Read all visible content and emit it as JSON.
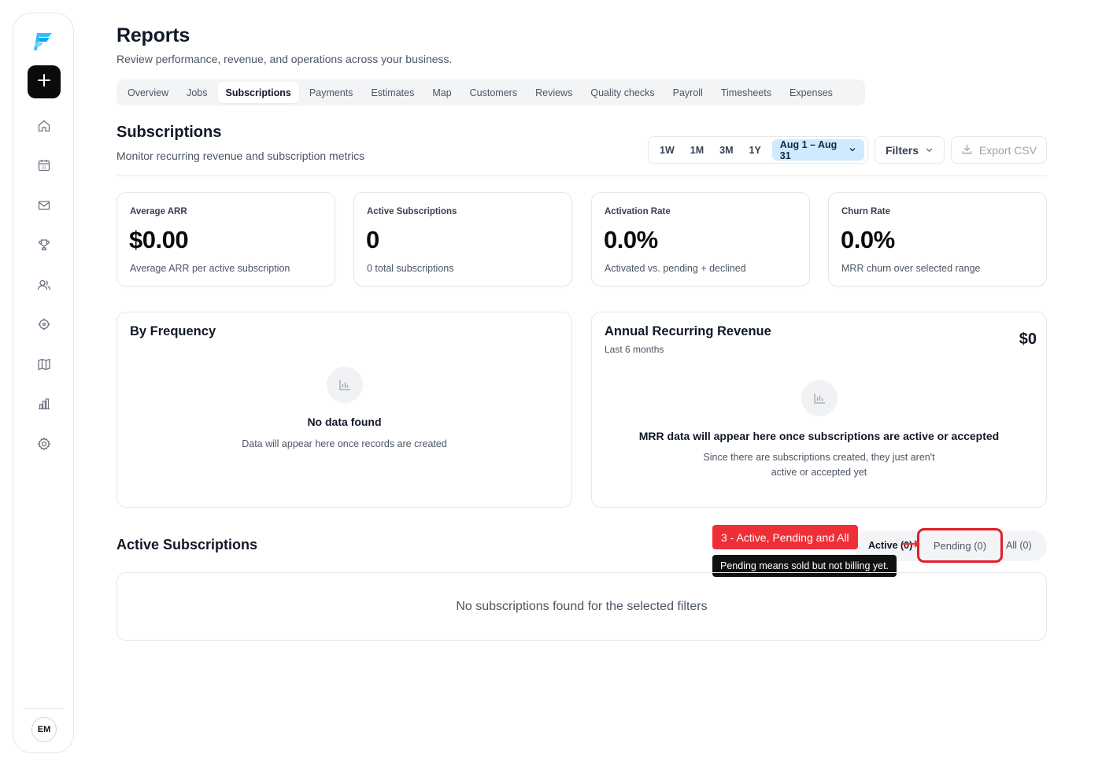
{
  "header": {
    "title": "Reports",
    "subtitle": "Review performance, revenue, and operations across your business."
  },
  "tabs": [
    {
      "label": "Overview"
    },
    {
      "label": "Jobs"
    },
    {
      "label": "Subscriptions",
      "active": true
    },
    {
      "label": "Payments"
    },
    {
      "label": "Estimates"
    },
    {
      "label": "Map"
    },
    {
      "label": "Customers"
    },
    {
      "label": "Reviews"
    },
    {
      "label": "Quality checks"
    },
    {
      "label": "Payroll"
    },
    {
      "label": "Timesheets"
    },
    {
      "label": "Expenses"
    }
  ],
  "section": {
    "title": "Subscriptions",
    "subtitle": "Monitor recurring revenue and subscription metrics"
  },
  "range": {
    "options": [
      "1W",
      "1M",
      "3M",
      "1Y"
    ],
    "selected": "Aug 1 – Aug 31"
  },
  "toolbar": {
    "filters_label": "Filters",
    "export_label": "Export CSV"
  },
  "stats": [
    {
      "label": "Average ARR",
      "value": "$0.00",
      "desc": "Average ARR per active subscription"
    },
    {
      "label": "Active Subscriptions",
      "value": "0",
      "desc": "0 total subscriptions"
    },
    {
      "label": "Activation Rate",
      "value": "0.0%",
      "desc": "Activated vs. pending + declined"
    },
    {
      "label": "Churn Rate",
      "value": "0.0%",
      "desc": "MRR churn over selected range"
    }
  ],
  "frequency_panel": {
    "title": "By Frequency",
    "empty_title": "No data found",
    "empty_desc": "Data will appear here once records are created"
  },
  "arr_panel": {
    "title": "Annual Recurring Revenue",
    "subtitle": "Last 6 months",
    "amount": "$0",
    "empty_title": "MRR data will appear here once subscriptions are active or accepted",
    "empty_desc_line1": "Since there are subscriptions created, they just aren't",
    "empty_desc_line2": "active or accepted yet"
  },
  "subscriptions": {
    "title": "Active Subscriptions",
    "segments": {
      "active": "Active (0)",
      "pending": "Pending (0)",
      "all": "All (0)"
    },
    "empty_message": "No subscriptions found for the selected filters"
  },
  "annotation": {
    "callout": "3 - Active, Pending and All",
    "tooltip": "Pending means sold but not billing yet."
  },
  "user": {
    "initials": "EM"
  },
  "colors": {
    "accent_blue": "#cfeafd",
    "callout_red": "#ef2f37",
    "highlight_border": "#e11d2a",
    "logo_blue": "#38bdf8"
  },
  "sidebar_icons": [
    "home-icon",
    "calendar-icon",
    "mail-icon",
    "trophy-icon",
    "users-icon",
    "target-icon",
    "map-icon",
    "bar-chart-icon",
    "gear-icon"
  ]
}
